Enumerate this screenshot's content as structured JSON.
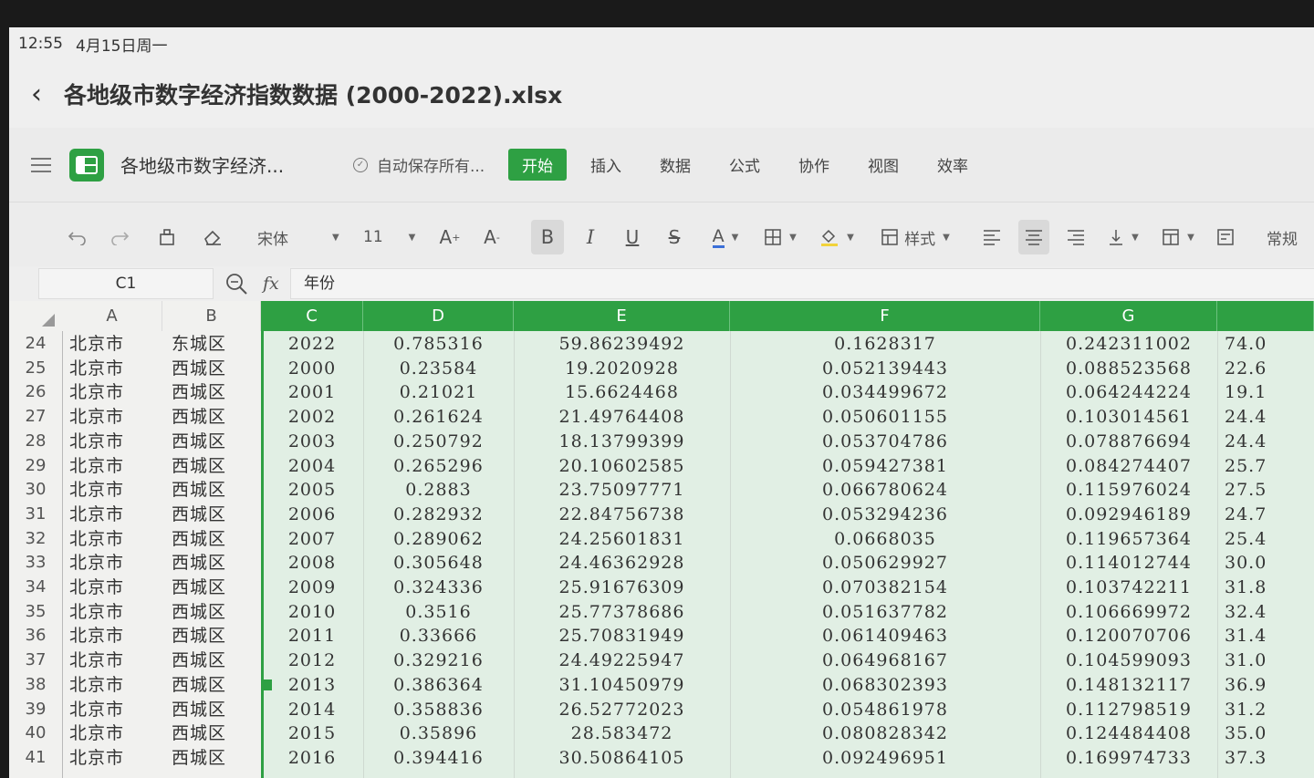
{
  "status": {
    "time": "12:55",
    "date": "4月15日周一"
  },
  "titlebar": {
    "filename": "各地级市数字经济指数数据 (2000-2022).xlsx"
  },
  "menubar": {
    "doc_title": "各地级市数字经济...",
    "autosave": "自动保存所有...",
    "tabs": [
      "开始",
      "插入",
      "数据",
      "公式",
      "协作",
      "视图",
      "效率"
    ]
  },
  "toolbar": {
    "font": "宋体",
    "font_size": "11",
    "style_label": "样式",
    "number_format": "常规",
    "font_color": "#3b6fd8",
    "fill_color": "#f2d33a"
  },
  "formula_bar": {
    "cell_ref": "C1",
    "formula": "年份"
  },
  "columns": [
    "A",
    "B",
    "C",
    "D",
    "E",
    "F",
    "G"
  ],
  "rows": [
    {
      "n": "24",
      "a": "北京市",
      "b": "东城区",
      "c": "2022",
      "d": "0.785316",
      "e": "59.86239492",
      "f": "0.1628317",
      "g": "0.242311002",
      "h": "74.0"
    },
    {
      "n": "25",
      "a": "北京市",
      "b": "西城区",
      "c": "2000",
      "d": "0.23584",
      "e": "19.2020928",
      "f": "0.052139443",
      "g": "0.088523568",
      "h": "22.6"
    },
    {
      "n": "26",
      "a": "北京市",
      "b": "西城区",
      "c": "2001",
      "d": "0.21021",
      "e": "15.6624468",
      "f": "0.034499672",
      "g": "0.064244224",
      "h": "19.1"
    },
    {
      "n": "27",
      "a": "北京市",
      "b": "西城区",
      "c": "2002",
      "d": "0.261624",
      "e": "21.49764408",
      "f": "0.050601155",
      "g": "0.103014561",
      "h": "24.4"
    },
    {
      "n": "28",
      "a": "北京市",
      "b": "西城区",
      "c": "2003",
      "d": "0.250792",
      "e": "18.13799399",
      "f": "0.053704786",
      "g": "0.078876694",
      "h": "24.4"
    },
    {
      "n": "29",
      "a": "北京市",
      "b": "西城区",
      "c": "2004",
      "d": "0.265296",
      "e": "20.10602585",
      "f": "0.059427381",
      "g": "0.084274407",
      "h": "25.7"
    },
    {
      "n": "30",
      "a": "北京市",
      "b": "西城区",
      "c": "2005",
      "d": "0.2883",
      "e": "23.75097771",
      "f": "0.066780624",
      "g": "0.115976024",
      "h": "27.5"
    },
    {
      "n": "31",
      "a": "北京市",
      "b": "西城区",
      "c": "2006",
      "d": "0.282932",
      "e": "22.84756738",
      "f": "0.053294236",
      "g": "0.092946189",
      "h": "24.7"
    },
    {
      "n": "32",
      "a": "北京市",
      "b": "西城区",
      "c": "2007",
      "d": "0.289062",
      "e": "24.25601831",
      "f": "0.0668035",
      "g": "0.119657364",
      "h": "25.4"
    },
    {
      "n": "33",
      "a": "北京市",
      "b": "西城区",
      "c": "2008",
      "d": "0.305648",
      "e": "24.46362928",
      "f": "0.050629927",
      "g": "0.114012744",
      "h": "30.0"
    },
    {
      "n": "34",
      "a": "北京市",
      "b": "西城区",
      "c": "2009",
      "d": "0.324336",
      "e": "25.91676309",
      "f": "0.070382154",
      "g": "0.103742211",
      "h": "31.8"
    },
    {
      "n": "35",
      "a": "北京市",
      "b": "西城区",
      "c": "2010",
      "d": "0.3516",
      "e": "25.77378686",
      "f": "0.051637782",
      "g": "0.106669972",
      "h": "32.4"
    },
    {
      "n": "36",
      "a": "北京市",
      "b": "西城区",
      "c": "2011",
      "d": "0.33666",
      "e": "25.70831949",
      "f": "0.061409463",
      "g": "0.120070706",
      "h": "31.4"
    },
    {
      "n": "37",
      "a": "北京市",
      "b": "西城区",
      "c": "2012",
      "d": "0.329216",
      "e": "24.49225947",
      "f": "0.064968167",
      "g": "0.104599093",
      "h": "31.0"
    },
    {
      "n": "38",
      "a": "北京市",
      "b": "西城区",
      "c": "2013",
      "d": "0.386364",
      "e": "31.10450979",
      "f": "0.068302393",
      "g": "0.148132117",
      "h": "36.9"
    },
    {
      "n": "39",
      "a": "北京市",
      "b": "西城区",
      "c": "2014",
      "d": "0.358836",
      "e": "26.52772023",
      "f": "0.054861978",
      "g": "0.112798519",
      "h": "31.2"
    },
    {
      "n": "40",
      "a": "北京市",
      "b": "西城区",
      "c": "2015",
      "d": "0.35896",
      "e": "28.583472",
      "f": "0.080828342",
      "g": "0.124484408",
      "h": "35.0"
    },
    {
      "n": "41",
      "a": "北京市",
      "b": "西城区",
      "c": "2016",
      "d": "0.394416",
      "e": "30.50864105",
      "f": "0.092496951",
      "g": "0.169974733",
      "h": "37.3"
    }
  ]
}
